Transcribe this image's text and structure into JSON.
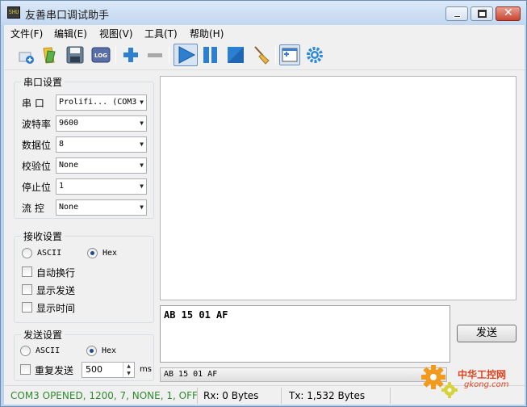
{
  "window": {
    "title": "友善串口调试助手",
    "icon_text": "SHU"
  },
  "menu": [
    "文件(F)",
    "编辑(E)",
    "视图(V)",
    "工具(T)",
    "帮助(H)"
  ],
  "toolbar": {
    "log_label": "LOG",
    "icons": [
      "new-icon",
      "open-icon",
      "save-icon",
      "log-icon",
      "add-icon",
      "remove-icon",
      "play-icon",
      "pause-icon",
      "stop-icon",
      "clear-broom-icon",
      "window-icon",
      "settings-gear-icon"
    ],
    "accent": "#2d7fd0"
  },
  "serial": {
    "title": "串口设置",
    "port_label": "串 口",
    "port_value": "Prolifi... (COM3",
    "baud_label": "波特率",
    "baud_value": "9600",
    "databits_label": "数据位",
    "databits_value": "8",
    "parity_label": "校验位",
    "parity_value": "None",
    "stopbits_label": "停止位",
    "stopbits_value": "1",
    "flow_label": "流 控",
    "flow_value": "None"
  },
  "receive": {
    "title": "接收设置",
    "ascii_label": "ASCII",
    "hex_label": "Hex",
    "selected": "Hex",
    "wrap_label": "自动换行",
    "show_send_label": "显示发送",
    "show_time_label": "显示时间"
  },
  "send": {
    "title": "发送设置",
    "ascii_label": "ASCII",
    "hex_label": "Hex",
    "selected": "Hex",
    "repeat_label": "重复发送",
    "interval_value": "500",
    "interval_unit": "ms",
    "input_text": "AB 15 01 AF",
    "button_label": "发送",
    "history_value": "AB 15 01 AF"
  },
  "status": {
    "port_status": "COM3 OPENED, 1200, 7, NONE, 1, OFF",
    "port_status_color": "#2f8a2f",
    "rx": "Rx: 0 Bytes",
    "tx": "Tx: 1,532 Bytes"
  },
  "watermark": {
    "line1": "中华工控网",
    "line2": "gkong.com"
  }
}
